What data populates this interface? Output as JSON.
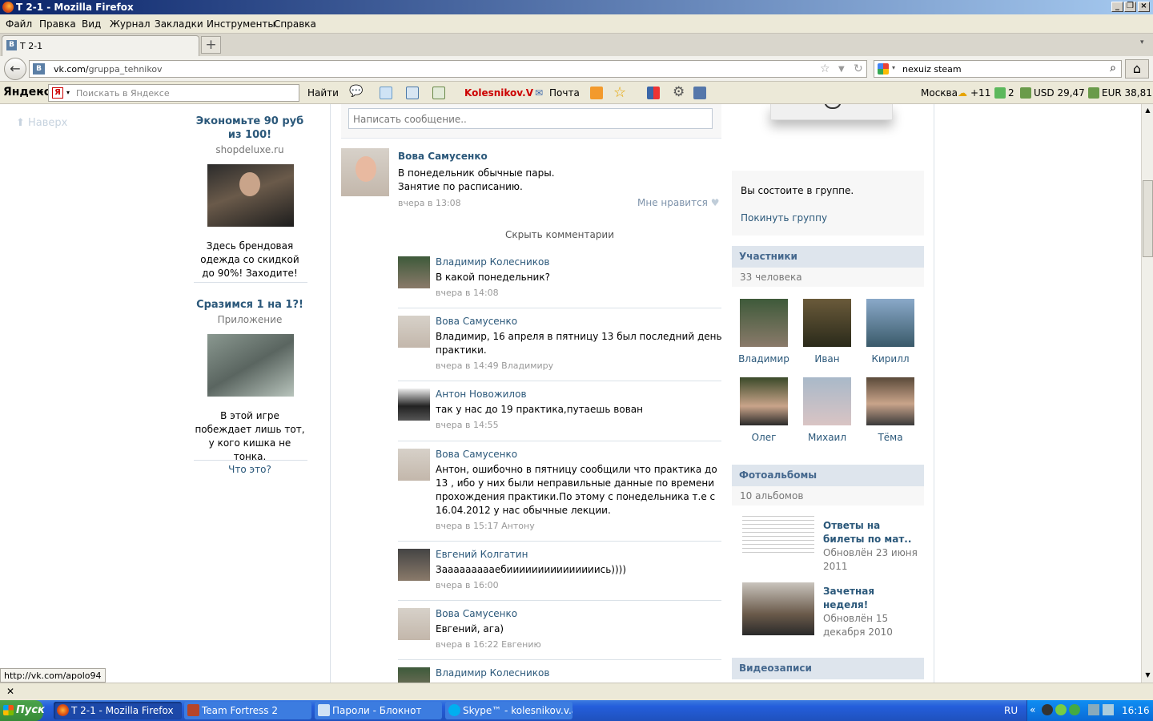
{
  "window": {
    "title": "Т 2-1 - Mozilla Firefox"
  },
  "menu": [
    "Файл",
    "Правка",
    "Вид",
    "Журнал",
    "Закладки",
    "Инструменты",
    "Справка"
  ],
  "tab": {
    "label": "Т 2-1",
    "favicon": "В"
  },
  "nav": {
    "url_domain": "vk.com/",
    "url_path": "gruppa_tehnikov",
    "search_value": "nexuiz steam"
  },
  "yandex": {
    "logo": "Яндекс",
    "search_placeholder": "Поискать в Яндексе",
    "find_label": "Найти",
    "user": "Kolesnikov.V",
    "mail": "Почта",
    "city": "Москва",
    "weather": "+11",
    "traffic": "2",
    "usd": "USD 29,47",
    "eur": "EUR 38,81"
  },
  "content": {
    "back_to_top": "Наверх",
    "ads": [
      {
        "title": "Экономьте 90 руб из 100!",
        "domain": "shopdeluxe.ru",
        "text": "Здесь брендовая одежда со скидкой до 90%! Заходите!"
      },
      {
        "title": "Сразимся 1 на 1?!",
        "domain": "Приложение",
        "text": "В этой игре побеждает лишь тот, у кого кишка не тонка."
      }
    ],
    "what_is_this": "Что это?",
    "write_placeholder": "Написать сообщение..",
    "post": {
      "author": "Вова Самусенко",
      "text_line1": "В понедельник обычные пары.",
      "text_line2": "Занятие по расписанию.",
      "date": "вчера в 13:08",
      "like": "Мне нравится",
      "hide_comments": "Скрыть комментарии"
    },
    "comments": [
      {
        "author": "Владимир Колесников",
        "text": "В какой понедельник?",
        "date": "вчера в 14:08"
      },
      {
        "author": "Вова Самусенко",
        "text": "Владимир, 16 апреля в пятницу 13 был последний день практики.",
        "date": "вчера в 14:49 Владимиру"
      },
      {
        "author": "Антон Новожилов",
        "text": "так у нас до 19 практика,путаешь вован",
        "date": "вчера в 14:55"
      },
      {
        "author": "Вова Самусенко",
        "text": "Антон, ошибочно в пятницу сообщили что практика до 13 , ибо у них были неправильные данные по времени прохождения практики.По этому с понедельника т.е с 16.04.2012 у нас обычные лекции.",
        "date": "вчера в 15:17 Антону"
      },
      {
        "author": "Евгений Колгатин",
        "text": "Заааааааааебииииииииииииииись))))",
        "date": "вчера в 16:00"
      },
      {
        "author": "Вова Самусенко",
        "text": "Евгений, ага)",
        "date": "вчера в 16:22 Евгению"
      },
      {
        "author": "Владимир Колесников",
        "text": "",
        "date": ""
      }
    ],
    "group": {
      "member_text": "Вы состоите в группе.",
      "leave": "Покинуть группу"
    },
    "members": {
      "title": "Участники",
      "count": "33 человека",
      "list": [
        "Владимир",
        "Иван",
        "Кирилл",
        "Олег",
        "Михаил",
        "Тёма"
      ]
    },
    "albums": {
      "title": "Фотоальбомы",
      "count": "10 альбомов",
      "list": [
        {
          "name": "Ответы на билеты по мат..",
          "updated": "Обновлён 23 июня 2011"
        },
        {
          "name": "Зачетная неделя!",
          "updated": "Обновлён 15 декабря 2010"
        }
      ]
    },
    "videos": {
      "title": "Видеозаписи"
    }
  },
  "status_link": "http://vk.com/apolo94",
  "taskbar": {
    "start": "Пуск",
    "tasks": [
      "Т 2-1 - Mozilla Firefox",
      "Team Fortress 2",
      "Пароли - Блокнот",
      "Skype™ - kolesnikov.v.a..."
    ],
    "lang": "RU",
    "clock": "16:16"
  }
}
